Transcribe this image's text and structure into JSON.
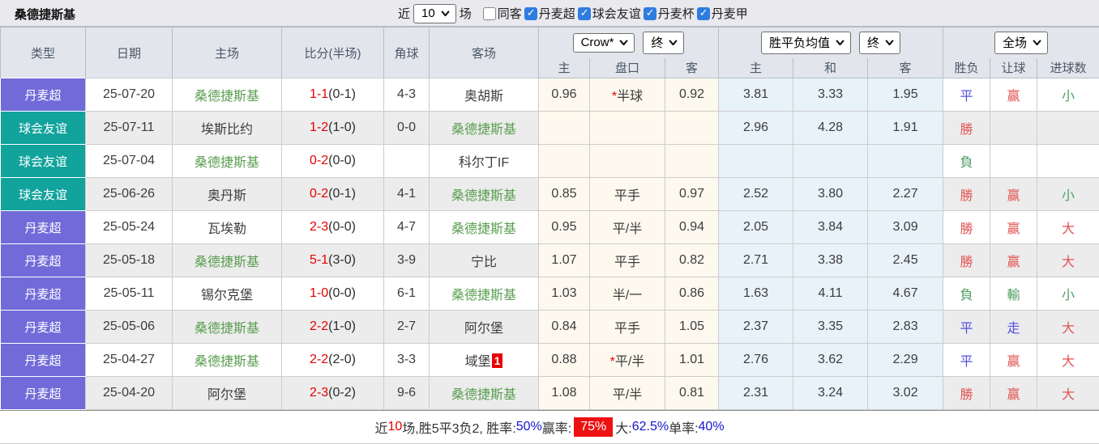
{
  "title": "桑德捷斯基",
  "controls": {
    "near_label": "近",
    "matches_value": "10",
    "matches_label": "场",
    "checkboxes": [
      {
        "label": "同客",
        "checked": false
      },
      {
        "label": "丹麦超",
        "checked": true
      },
      {
        "label": "球会友谊",
        "checked": true
      },
      {
        "label": "丹麦杯",
        "checked": true
      },
      {
        "label": "丹麦甲",
        "checked": true
      }
    ]
  },
  "header": {
    "columns": [
      "类型",
      "日期",
      "主场",
      "比分(半场)",
      "角球",
      "客场"
    ],
    "odds_company": "Crow*",
    "odds_time": "终",
    "avg_name": "胜平负均值",
    "avg_time": "终",
    "period": "全场",
    "sub": [
      "主",
      "盘口",
      "客",
      "主",
      "和",
      "客",
      "胜负",
      "让球",
      "进球数"
    ]
  },
  "rows": [
    {
      "league": "丹麦超",
      "league_color": "purple",
      "date": "25-07-20",
      "home": "桑德捷斯基",
      "home_self": true,
      "score_full": "1-1",
      "score_half": "(0-1)",
      "corners": "4-3",
      "away": "奥胡斯",
      "away_self": false,
      "away_badge": "",
      "odds_home": "0.96",
      "handicap": "半球",
      "handicap_star": true,
      "odds_away": "0.92",
      "avg_home": "3.81",
      "avg_draw": "3.33",
      "avg_away": "1.95",
      "result": "平",
      "result_color": "blue",
      "let_result": "赢",
      "let_color": "red",
      "goals": "小",
      "goals_color": "green"
    },
    {
      "league": "球会友谊",
      "league_color": "teal",
      "date": "25-07-11",
      "home": "埃斯比约",
      "home_self": false,
      "score_full": "1-2",
      "score_half": "(1-0)",
      "corners": "0-0",
      "away": "桑德捷斯基",
      "away_self": true,
      "away_badge": "",
      "odds_home": "",
      "handicap": "",
      "handicap_star": false,
      "odds_away": "",
      "avg_home": "2.96",
      "avg_draw": "4.28",
      "avg_away": "1.91",
      "result": "勝",
      "result_color": "red",
      "let_result": "",
      "let_color": "",
      "goals": "",
      "goals_color": ""
    },
    {
      "league": "球会友谊",
      "league_color": "teal",
      "date": "25-07-04",
      "home": "桑德捷斯基",
      "home_self": true,
      "score_full": "0-2",
      "score_half": "(0-0)",
      "corners": "",
      "away": "科尔丁IF",
      "away_self": false,
      "away_badge": "",
      "odds_home": "",
      "handicap": "",
      "handicap_star": false,
      "odds_away": "",
      "avg_home": "",
      "avg_draw": "",
      "avg_away": "",
      "result": "負",
      "result_color": "green",
      "let_result": "",
      "let_color": "",
      "goals": "",
      "goals_color": ""
    },
    {
      "league": "球会友谊",
      "league_color": "teal",
      "date": "25-06-26",
      "home": "奥丹斯",
      "home_self": false,
      "score_full": "0-2",
      "score_half": "(0-1)",
      "corners": "4-1",
      "away": "桑德捷斯基",
      "away_self": true,
      "away_badge": "",
      "odds_home": "0.85",
      "handicap": "平手",
      "handicap_star": false,
      "odds_away": "0.97",
      "avg_home": "2.52",
      "avg_draw": "3.80",
      "avg_away": "2.27",
      "result": "勝",
      "result_color": "red",
      "let_result": "赢",
      "let_color": "red",
      "goals": "小",
      "goals_color": "green"
    },
    {
      "league": "丹麦超",
      "league_color": "purple",
      "date": "25-05-24",
      "home": "瓦埃勒",
      "home_self": false,
      "score_full": "2-3",
      "score_half": "(0-0)",
      "corners": "4-7",
      "away": "桑德捷斯基",
      "away_self": true,
      "away_badge": "",
      "odds_home": "0.95",
      "handicap": "平/半",
      "handicap_star": false,
      "odds_away": "0.94",
      "avg_home": "2.05",
      "avg_draw": "3.84",
      "avg_away": "3.09",
      "result": "勝",
      "result_color": "red",
      "let_result": "赢",
      "let_color": "red",
      "goals": "大",
      "goals_color": "red"
    },
    {
      "league": "丹麦超",
      "league_color": "purple",
      "date": "25-05-18",
      "home": "桑德捷斯基",
      "home_self": true,
      "score_full": "5-1",
      "score_half": "(3-0)",
      "corners": "3-9",
      "away": "宁比",
      "away_self": false,
      "away_badge": "",
      "odds_home": "1.07",
      "handicap": "平手",
      "handicap_star": false,
      "odds_away": "0.82",
      "avg_home": "2.71",
      "avg_draw": "3.38",
      "avg_away": "2.45",
      "result": "勝",
      "result_color": "red",
      "let_result": "赢",
      "let_color": "red",
      "goals": "大",
      "goals_color": "red"
    },
    {
      "league": "丹麦超",
      "league_color": "purple",
      "date": "25-05-11",
      "home": "锡尔克堡",
      "home_self": false,
      "score_full": "1-0",
      "score_half": "(0-0)",
      "corners": "6-1",
      "away": "桑德捷斯基",
      "away_self": true,
      "away_badge": "",
      "odds_home": "1.03",
      "handicap": "半/一",
      "handicap_star": false,
      "odds_away": "0.86",
      "avg_home": "1.63",
      "avg_draw": "4.11",
      "avg_away": "4.67",
      "result": "負",
      "result_color": "green",
      "let_result": "輸",
      "let_color": "green",
      "goals": "小",
      "goals_color": "green"
    },
    {
      "league": "丹麦超",
      "league_color": "purple",
      "date": "25-05-06",
      "home": "桑德捷斯基",
      "home_self": true,
      "score_full": "2-2",
      "score_half": "(1-0)",
      "corners": "2-7",
      "away": "阿尔堡",
      "away_self": false,
      "away_badge": "",
      "odds_home": "0.84",
      "handicap": "平手",
      "handicap_star": false,
      "odds_away": "1.05",
      "avg_home": "2.37",
      "avg_draw": "3.35",
      "avg_away": "2.83",
      "result": "平",
      "result_color": "blue",
      "let_result": "走",
      "let_color": "blue",
      "goals": "大",
      "goals_color": "red"
    },
    {
      "league": "丹麦超",
      "league_color": "purple",
      "date": "25-04-27",
      "home": "桑德捷斯基",
      "home_self": true,
      "score_full": "2-2",
      "score_half": "(2-0)",
      "corners": "3-3",
      "away": "域堡",
      "away_self": false,
      "away_badge": "1",
      "odds_home": "0.88",
      "handicap": "平/半",
      "handicap_star": true,
      "odds_away": "1.01",
      "avg_home": "2.76",
      "avg_draw": "3.62",
      "avg_away": "2.29",
      "result": "平",
      "result_color": "blue",
      "let_result": "赢",
      "let_color": "red",
      "goals": "大",
      "goals_color": "red"
    },
    {
      "league": "丹麦超",
      "league_color": "purple",
      "date": "25-04-20",
      "home": "阿尔堡",
      "home_self": false,
      "score_full": "2-3",
      "score_half": "(0-2)",
      "corners": "9-6",
      "away": "桑德捷斯基",
      "away_self": true,
      "away_badge": "",
      "odds_home": "1.08",
      "handicap": "平/半",
      "handicap_star": false,
      "odds_away": "0.81",
      "avg_home": "2.31",
      "avg_draw": "3.24",
      "avg_away": "3.02",
      "result": "勝",
      "result_color": "red",
      "let_result": "赢",
      "let_color": "red",
      "goals": "大",
      "goals_color": "red"
    }
  ],
  "summary": {
    "segments": [
      {
        "text": "近",
        "style": "dark"
      },
      {
        "text": "10",
        "style": "red"
      },
      {
        "text": "场,胜5平3负2, 胜率:",
        "style": "dark"
      },
      {
        "text": "50%",
        "style": "blue"
      },
      {
        "text": " 赢率:",
        "style": "dark"
      },
      {
        "text": "75%",
        "style": "badge"
      },
      {
        "text": " 大:",
        "style": "dark"
      },
      {
        "text": "62.5%",
        "style": "blue"
      },
      {
        "text": " 单率:",
        "style": "dark"
      },
      {
        "text": "40%",
        "style": "blue"
      }
    ]
  },
  "colors": {
    "league_purple": "#716bd9",
    "league_teal": "#11a39c",
    "team_self_green": "#5a9e50",
    "score_red": "#e60000",
    "result_red": "#e25252",
    "result_green": "#4f9e63",
    "result_blue": "#5050e0",
    "summary_blue": "#1515cc",
    "summary_badge_red": "#ee1111",
    "checkbox_blue": "#2f7ce0",
    "odds_bg": "#fdf9ee",
    "avg_bg": "#e8f2f9",
    "row_alt_bg": "#ececec"
  }
}
